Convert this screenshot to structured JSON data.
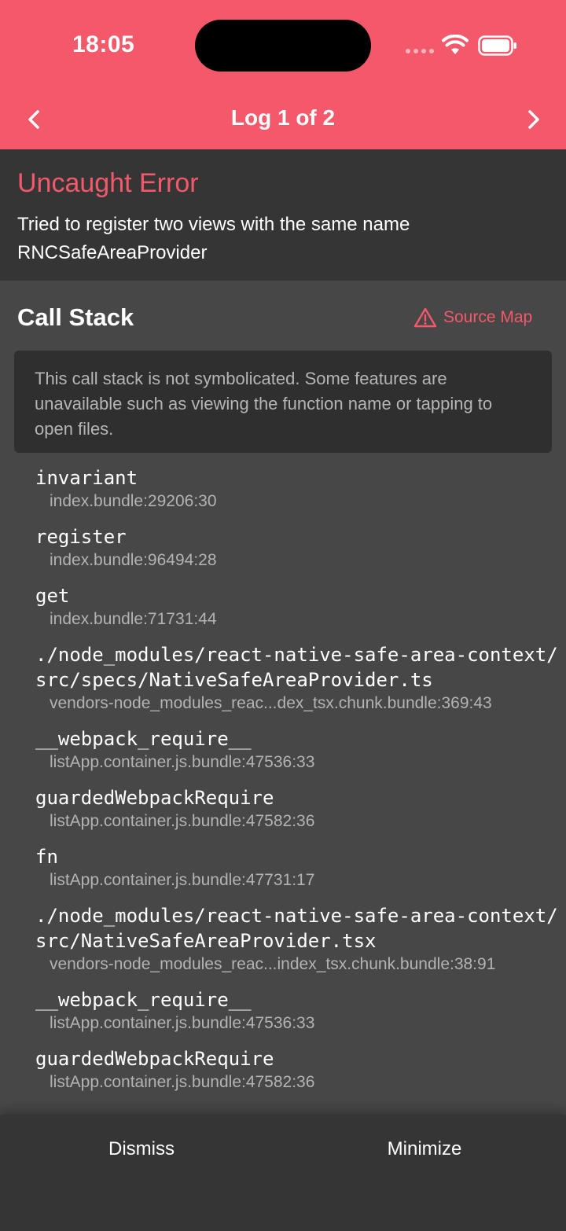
{
  "status_bar": {
    "time": "18:05"
  },
  "nav": {
    "title": "Log 1 of 2"
  },
  "error": {
    "title": "Uncaught Error",
    "message": "Tried to register two views with the same name RNCSafeAreaProvider"
  },
  "call_stack": {
    "title": "Call Stack",
    "source_map_label": "Source Map",
    "notice": "This call stack is not symbolicated. Some features are unavailable such as viewing the function name or tapping to open files.",
    "frames": [
      {
        "name": "invariant",
        "location": "index.bundle:29206:30"
      },
      {
        "name": "register",
        "location": "index.bundle:96494:28"
      },
      {
        "name": "get",
        "location": "index.bundle:71731:44"
      },
      {
        "name": "./node_modules/react-native-safe-area-context/src/specs/NativeSafeAreaProvider.ts",
        "location": "vendors-node_modules_reac...dex_tsx.chunk.bundle:369:43"
      },
      {
        "name": "__webpack_require__",
        "location": "listApp.container.js.bundle:47536:33"
      },
      {
        "name": "guardedWebpackRequire",
        "location": "listApp.container.js.bundle:47582:36"
      },
      {
        "name": "fn",
        "location": "listApp.container.js.bundle:47731:17"
      },
      {
        "name": "./node_modules/react-native-safe-area-context/src/NativeSafeAreaProvider.tsx",
        "location": "vendors-node_modules_reac...index_tsx.chunk.bundle:38:91"
      },
      {
        "name": "__webpack_require__",
        "location": "listApp.container.js.bundle:47536:33"
      },
      {
        "name": "guardedWebpackRequire",
        "location": "listApp.container.js.bundle:47582:36"
      }
    ]
  },
  "actions": {
    "dismiss": "Dismiss",
    "minimize": "Minimize"
  },
  "colors": {
    "accent": "#f3596a",
    "surface": "#353535",
    "background": "#474747"
  }
}
